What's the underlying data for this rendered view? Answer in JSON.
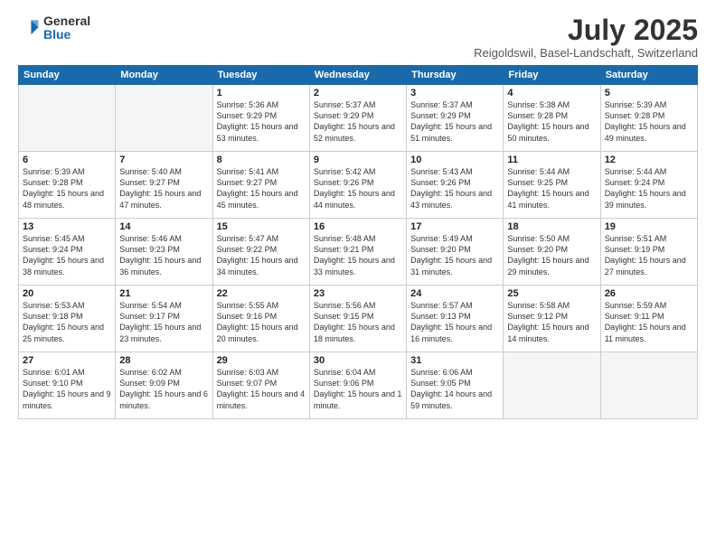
{
  "header": {
    "logo_general": "General",
    "logo_blue": "Blue",
    "month_title": "July 2025",
    "location": "Reigoldswil, Basel-Landschaft, Switzerland"
  },
  "weekdays": [
    "Sunday",
    "Monday",
    "Tuesday",
    "Wednesday",
    "Thursday",
    "Friday",
    "Saturday"
  ],
  "weeks": [
    [
      {
        "day": "",
        "info": ""
      },
      {
        "day": "",
        "info": ""
      },
      {
        "day": "1",
        "info": "Sunrise: 5:36 AM\nSunset: 9:29 PM\nDaylight: 15 hours\nand 53 minutes."
      },
      {
        "day": "2",
        "info": "Sunrise: 5:37 AM\nSunset: 9:29 PM\nDaylight: 15 hours\nand 52 minutes."
      },
      {
        "day": "3",
        "info": "Sunrise: 5:37 AM\nSunset: 9:29 PM\nDaylight: 15 hours\nand 51 minutes."
      },
      {
        "day": "4",
        "info": "Sunrise: 5:38 AM\nSunset: 9:28 PM\nDaylight: 15 hours\nand 50 minutes."
      },
      {
        "day": "5",
        "info": "Sunrise: 5:39 AM\nSunset: 9:28 PM\nDaylight: 15 hours\nand 49 minutes."
      }
    ],
    [
      {
        "day": "6",
        "info": "Sunrise: 5:39 AM\nSunset: 9:28 PM\nDaylight: 15 hours\nand 48 minutes."
      },
      {
        "day": "7",
        "info": "Sunrise: 5:40 AM\nSunset: 9:27 PM\nDaylight: 15 hours\nand 47 minutes."
      },
      {
        "day": "8",
        "info": "Sunrise: 5:41 AM\nSunset: 9:27 PM\nDaylight: 15 hours\nand 45 minutes."
      },
      {
        "day": "9",
        "info": "Sunrise: 5:42 AM\nSunset: 9:26 PM\nDaylight: 15 hours\nand 44 minutes."
      },
      {
        "day": "10",
        "info": "Sunrise: 5:43 AM\nSunset: 9:26 PM\nDaylight: 15 hours\nand 43 minutes."
      },
      {
        "day": "11",
        "info": "Sunrise: 5:44 AM\nSunset: 9:25 PM\nDaylight: 15 hours\nand 41 minutes."
      },
      {
        "day": "12",
        "info": "Sunrise: 5:44 AM\nSunset: 9:24 PM\nDaylight: 15 hours\nand 39 minutes."
      }
    ],
    [
      {
        "day": "13",
        "info": "Sunrise: 5:45 AM\nSunset: 9:24 PM\nDaylight: 15 hours\nand 38 minutes."
      },
      {
        "day": "14",
        "info": "Sunrise: 5:46 AM\nSunset: 9:23 PM\nDaylight: 15 hours\nand 36 minutes."
      },
      {
        "day": "15",
        "info": "Sunrise: 5:47 AM\nSunset: 9:22 PM\nDaylight: 15 hours\nand 34 minutes."
      },
      {
        "day": "16",
        "info": "Sunrise: 5:48 AM\nSunset: 9:21 PM\nDaylight: 15 hours\nand 33 minutes."
      },
      {
        "day": "17",
        "info": "Sunrise: 5:49 AM\nSunset: 9:20 PM\nDaylight: 15 hours\nand 31 minutes."
      },
      {
        "day": "18",
        "info": "Sunrise: 5:50 AM\nSunset: 9:20 PM\nDaylight: 15 hours\nand 29 minutes."
      },
      {
        "day": "19",
        "info": "Sunrise: 5:51 AM\nSunset: 9:19 PM\nDaylight: 15 hours\nand 27 minutes."
      }
    ],
    [
      {
        "day": "20",
        "info": "Sunrise: 5:53 AM\nSunset: 9:18 PM\nDaylight: 15 hours\nand 25 minutes."
      },
      {
        "day": "21",
        "info": "Sunrise: 5:54 AM\nSunset: 9:17 PM\nDaylight: 15 hours\nand 23 minutes."
      },
      {
        "day": "22",
        "info": "Sunrise: 5:55 AM\nSunset: 9:16 PM\nDaylight: 15 hours\nand 20 minutes."
      },
      {
        "day": "23",
        "info": "Sunrise: 5:56 AM\nSunset: 9:15 PM\nDaylight: 15 hours\nand 18 minutes."
      },
      {
        "day": "24",
        "info": "Sunrise: 5:57 AM\nSunset: 9:13 PM\nDaylight: 15 hours\nand 16 minutes."
      },
      {
        "day": "25",
        "info": "Sunrise: 5:58 AM\nSunset: 9:12 PM\nDaylight: 15 hours\nand 14 minutes."
      },
      {
        "day": "26",
        "info": "Sunrise: 5:59 AM\nSunset: 9:11 PM\nDaylight: 15 hours\nand 11 minutes."
      }
    ],
    [
      {
        "day": "27",
        "info": "Sunrise: 6:01 AM\nSunset: 9:10 PM\nDaylight: 15 hours\nand 9 minutes."
      },
      {
        "day": "28",
        "info": "Sunrise: 6:02 AM\nSunset: 9:09 PM\nDaylight: 15 hours\nand 6 minutes."
      },
      {
        "day": "29",
        "info": "Sunrise: 6:03 AM\nSunset: 9:07 PM\nDaylight: 15 hours\nand 4 minutes."
      },
      {
        "day": "30",
        "info": "Sunrise: 6:04 AM\nSunset: 9:06 PM\nDaylight: 15 hours\nand 1 minute."
      },
      {
        "day": "31",
        "info": "Sunrise: 6:06 AM\nSunset: 9:05 PM\nDaylight: 14 hours\nand 59 minutes."
      },
      {
        "day": "",
        "info": ""
      },
      {
        "day": "",
        "info": ""
      }
    ]
  ]
}
